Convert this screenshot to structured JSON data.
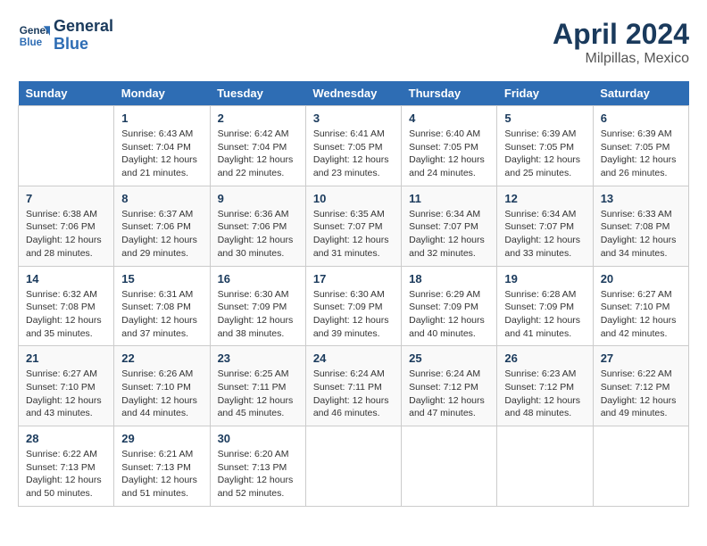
{
  "header": {
    "logo_line1": "General",
    "logo_line2": "Blue",
    "title": "April 2024",
    "subtitle": "Milpillas, Mexico"
  },
  "calendar": {
    "days_of_week": [
      "Sunday",
      "Monday",
      "Tuesday",
      "Wednesday",
      "Thursday",
      "Friday",
      "Saturday"
    ],
    "weeks": [
      [
        {
          "day": "",
          "info": ""
        },
        {
          "day": "1",
          "info": "Sunrise: 6:43 AM\nSunset: 7:04 PM\nDaylight: 12 hours\nand 21 minutes."
        },
        {
          "day": "2",
          "info": "Sunrise: 6:42 AM\nSunset: 7:04 PM\nDaylight: 12 hours\nand 22 minutes."
        },
        {
          "day": "3",
          "info": "Sunrise: 6:41 AM\nSunset: 7:05 PM\nDaylight: 12 hours\nand 23 minutes."
        },
        {
          "day": "4",
          "info": "Sunrise: 6:40 AM\nSunset: 7:05 PM\nDaylight: 12 hours\nand 24 minutes."
        },
        {
          "day": "5",
          "info": "Sunrise: 6:39 AM\nSunset: 7:05 PM\nDaylight: 12 hours\nand 25 minutes."
        },
        {
          "day": "6",
          "info": "Sunrise: 6:39 AM\nSunset: 7:05 PM\nDaylight: 12 hours\nand 26 minutes."
        }
      ],
      [
        {
          "day": "7",
          "info": "Sunrise: 6:38 AM\nSunset: 7:06 PM\nDaylight: 12 hours\nand 28 minutes."
        },
        {
          "day": "8",
          "info": "Sunrise: 6:37 AM\nSunset: 7:06 PM\nDaylight: 12 hours\nand 29 minutes."
        },
        {
          "day": "9",
          "info": "Sunrise: 6:36 AM\nSunset: 7:06 PM\nDaylight: 12 hours\nand 30 minutes."
        },
        {
          "day": "10",
          "info": "Sunrise: 6:35 AM\nSunset: 7:07 PM\nDaylight: 12 hours\nand 31 minutes."
        },
        {
          "day": "11",
          "info": "Sunrise: 6:34 AM\nSunset: 7:07 PM\nDaylight: 12 hours\nand 32 minutes."
        },
        {
          "day": "12",
          "info": "Sunrise: 6:34 AM\nSunset: 7:07 PM\nDaylight: 12 hours\nand 33 minutes."
        },
        {
          "day": "13",
          "info": "Sunrise: 6:33 AM\nSunset: 7:08 PM\nDaylight: 12 hours\nand 34 minutes."
        }
      ],
      [
        {
          "day": "14",
          "info": "Sunrise: 6:32 AM\nSunset: 7:08 PM\nDaylight: 12 hours\nand 35 minutes."
        },
        {
          "day": "15",
          "info": "Sunrise: 6:31 AM\nSunset: 7:08 PM\nDaylight: 12 hours\nand 37 minutes."
        },
        {
          "day": "16",
          "info": "Sunrise: 6:30 AM\nSunset: 7:09 PM\nDaylight: 12 hours\nand 38 minutes."
        },
        {
          "day": "17",
          "info": "Sunrise: 6:30 AM\nSunset: 7:09 PM\nDaylight: 12 hours\nand 39 minutes."
        },
        {
          "day": "18",
          "info": "Sunrise: 6:29 AM\nSunset: 7:09 PM\nDaylight: 12 hours\nand 40 minutes."
        },
        {
          "day": "19",
          "info": "Sunrise: 6:28 AM\nSunset: 7:09 PM\nDaylight: 12 hours\nand 41 minutes."
        },
        {
          "day": "20",
          "info": "Sunrise: 6:27 AM\nSunset: 7:10 PM\nDaylight: 12 hours\nand 42 minutes."
        }
      ],
      [
        {
          "day": "21",
          "info": "Sunrise: 6:27 AM\nSunset: 7:10 PM\nDaylight: 12 hours\nand 43 minutes."
        },
        {
          "day": "22",
          "info": "Sunrise: 6:26 AM\nSunset: 7:10 PM\nDaylight: 12 hours\nand 44 minutes."
        },
        {
          "day": "23",
          "info": "Sunrise: 6:25 AM\nSunset: 7:11 PM\nDaylight: 12 hours\nand 45 minutes."
        },
        {
          "day": "24",
          "info": "Sunrise: 6:24 AM\nSunset: 7:11 PM\nDaylight: 12 hours\nand 46 minutes."
        },
        {
          "day": "25",
          "info": "Sunrise: 6:24 AM\nSunset: 7:12 PM\nDaylight: 12 hours\nand 47 minutes."
        },
        {
          "day": "26",
          "info": "Sunrise: 6:23 AM\nSunset: 7:12 PM\nDaylight: 12 hours\nand 48 minutes."
        },
        {
          "day": "27",
          "info": "Sunrise: 6:22 AM\nSunset: 7:12 PM\nDaylight: 12 hours\nand 49 minutes."
        }
      ],
      [
        {
          "day": "28",
          "info": "Sunrise: 6:22 AM\nSunset: 7:13 PM\nDaylight: 12 hours\nand 50 minutes."
        },
        {
          "day": "29",
          "info": "Sunrise: 6:21 AM\nSunset: 7:13 PM\nDaylight: 12 hours\nand 51 minutes."
        },
        {
          "day": "30",
          "info": "Sunrise: 6:20 AM\nSunset: 7:13 PM\nDaylight: 12 hours\nand 52 minutes."
        },
        {
          "day": "",
          "info": ""
        },
        {
          "day": "",
          "info": ""
        },
        {
          "day": "",
          "info": ""
        },
        {
          "day": "",
          "info": ""
        }
      ]
    ]
  }
}
